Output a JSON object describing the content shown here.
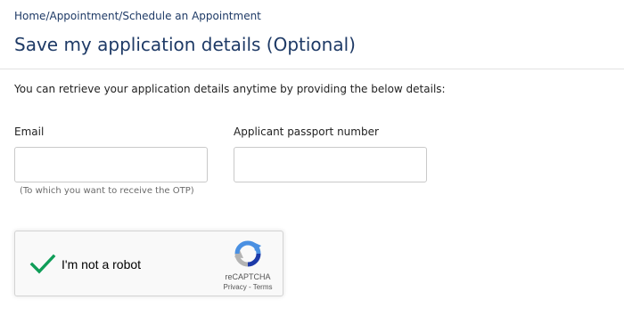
{
  "breadcrumb": {
    "items": [
      "Home",
      "Appointment",
      "Schedule an Appointment"
    ],
    "separator": "/"
  },
  "page": {
    "title": "Save my application details (Optional)",
    "intro": "You can retrieve your application details anytime by providing the below details:"
  },
  "form": {
    "email": {
      "label": "Email",
      "value": "",
      "placeholder": "",
      "hint": "(To which you want to receive the OTP)"
    },
    "passport": {
      "label": "Applicant passport number",
      "value": "",
      "placeholder": ""
    }
  },
  "recaptcha": {
    "label": "I'm not a robot",
    "checked": true,
    "brand": "reCAPTCHA",
    "privacy": "Privacy",
    "link_separator": " - ",
    "terms": "Terms",
    "check_color": "#0f9d58",
    "check_icon": "checkmark-icon",
    "logo_icon": "recaptcha-logo-icon"
  },
  "colors": {
    "heading": "#1e3a66",
    "text": "#222222",
    "hint": "#6b6b6b"
  }
}
